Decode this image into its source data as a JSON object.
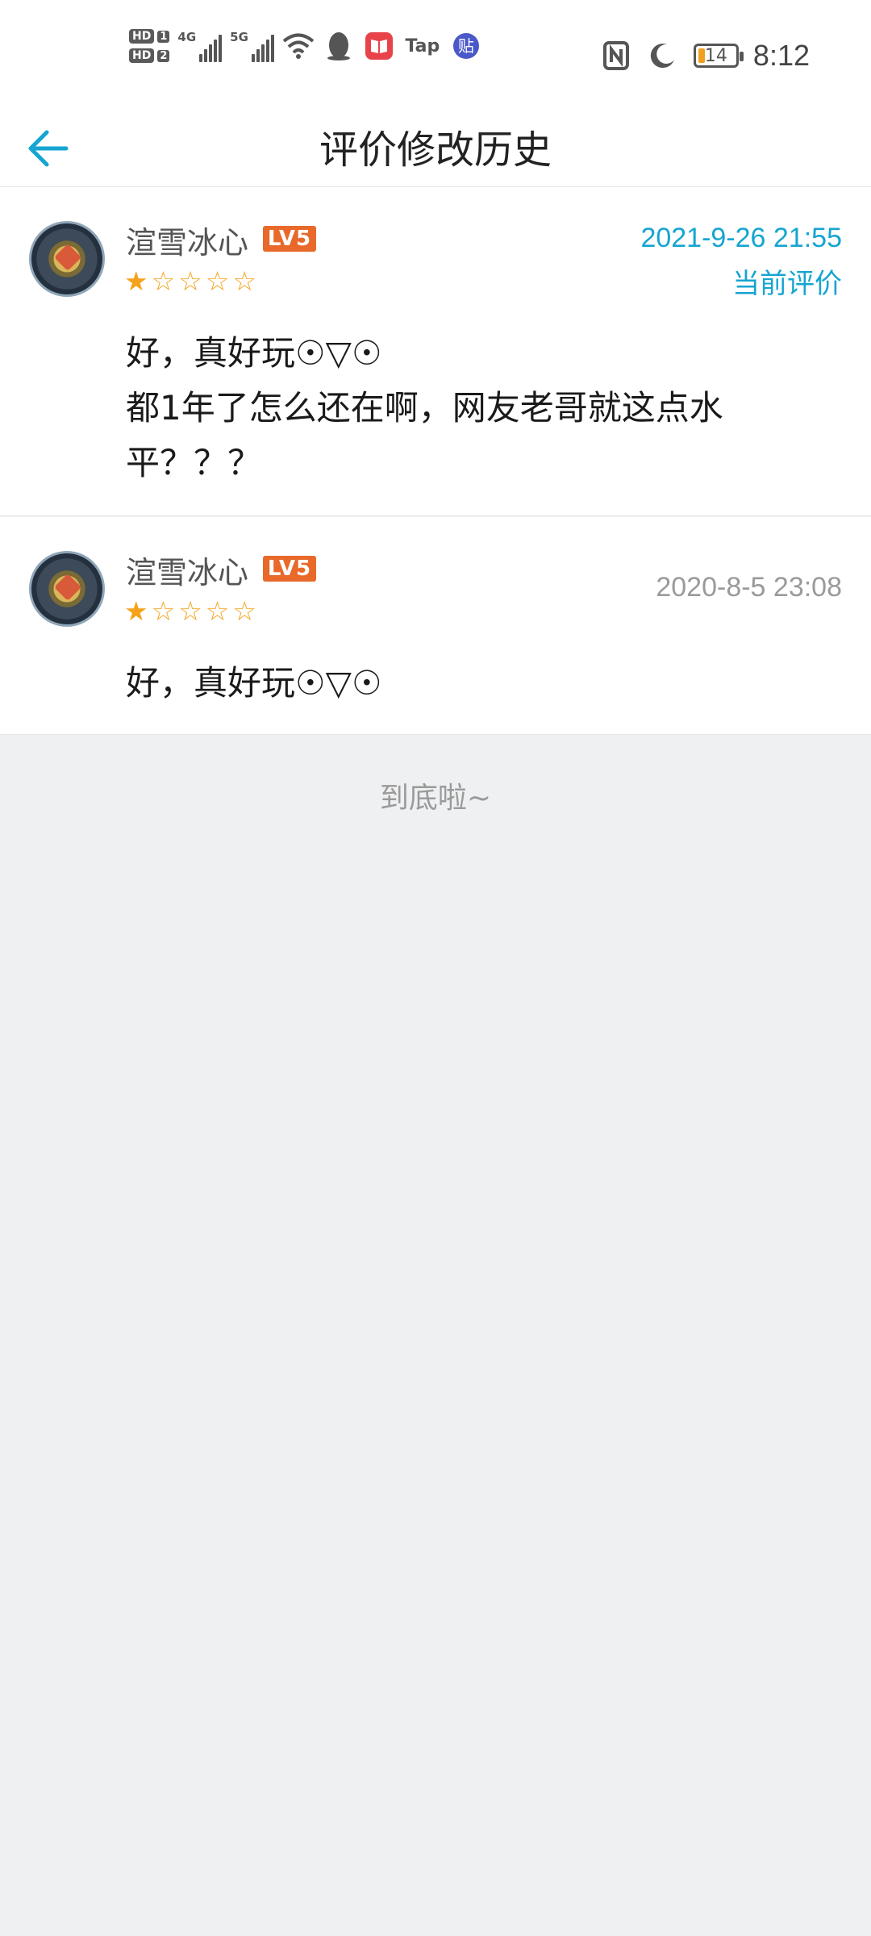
{
  "status_bar": {
    "time": "8:12",
    "battery_level": "14",
    "sim1_label": "HD",
    "sim1_num": "1",
    "sim2_label": "HD",
    "sim2_num": "2",
    "net1_type": "4G",
    "net2_type": "5G",
    "icons": [
      "wifi-icon",
      "qq-penguin-icon",
      "book-app-icon",
      "tap-app-icon",
      "tieba-app-icon",
      "nfc-icon",
      "moon-icon"
    ],
    "tap_label": "Tap",
    "tieba_label": "贴"
  },
  "header": {
    "title": "评价修改历史",
    "back_icon": "back-arrow-icon"
  },
  "colors": {
    "accent": "#16a5d1",
    "star": "#f6a31c",
    "level_badge": "#e8692a",
    "page_bg": "#eff0f2"
  },
  "reviews": [
    {
      "username": "渲雪冰心",
      "level": "LV5",
      "rating": 1,
      "max_rating": 5,
      "date": "2021-9-26 21:55",
      "tag": "当前评价",
      "lines": [
        "好，真好玩☉▽☉",
        "都1年了怎么还在啊，网友老哥就这点水",
        "平？？？"
      ]
    },
    {
      "username": "渲雪冰心",
      "level": "LV5",
      "rating": 1,
      "max_rating": 5,
      "date": "2020-8-5 23:08",
      "tag": "",
      "lines": [
        "好，真好玩☉▽☉"
      ]
    }
  ],
  "footer": {
    "end_text": "到底啦~"
  }
}
